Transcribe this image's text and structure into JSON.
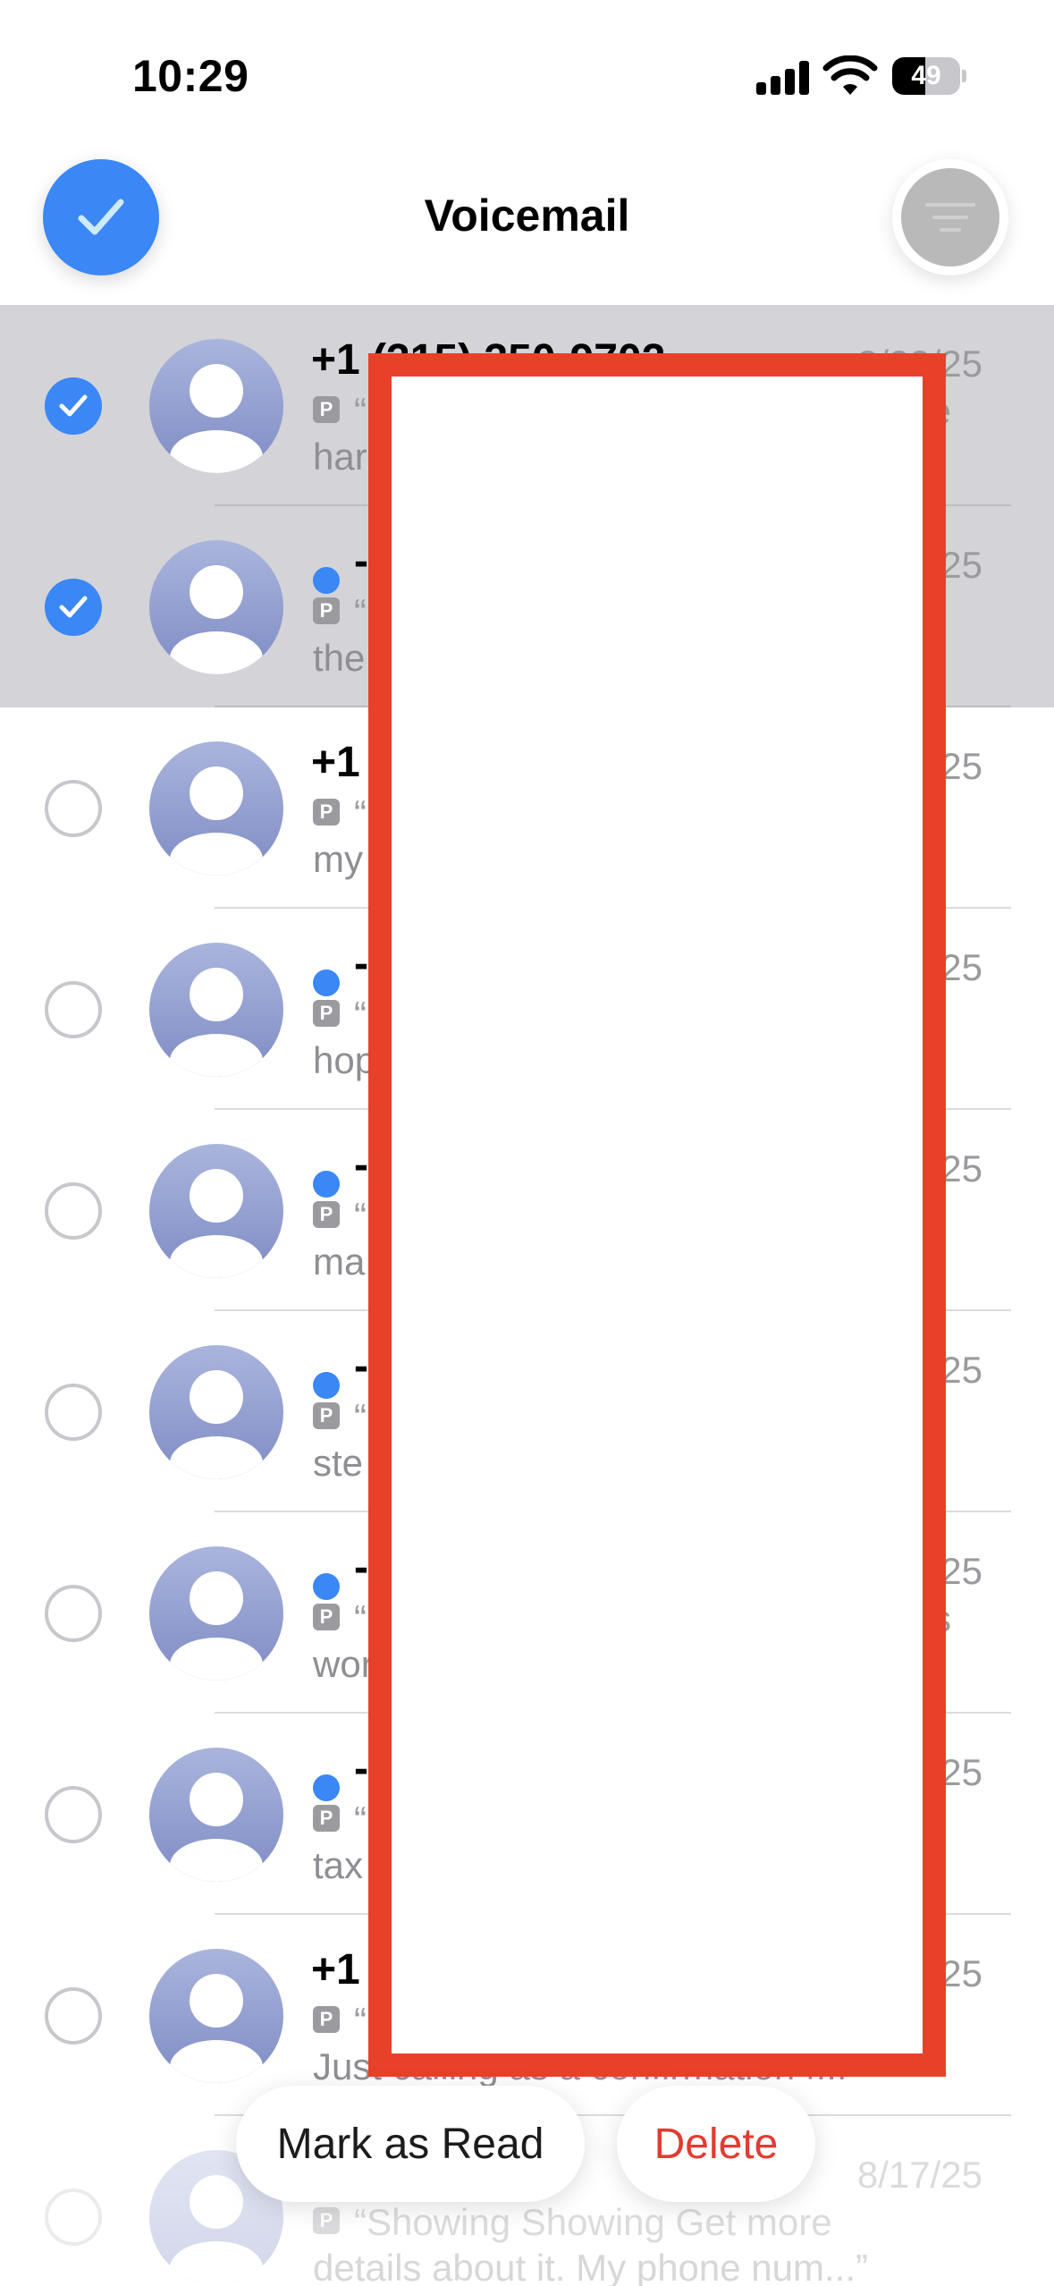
{
  "status_bar": {
    "time": "10:29",
    "battery_level": "49",
    "battery_fraction": 0.49,
    "icons": [
      "cellular-signal-icon",
      "wifi-icon",
      "battery-icon"
    ]
  },
  "nav": {
    "title": "Voicemail",
    "left_icon": "checkmark-icon",
    "right_icon": "filter-icon"
  },
  "colors": {
    "accent": "#3a87f5",
    "delete": "#e23b32",
    "redaction_border": "#e8412a",
    "selected_row": "#d3d3d8",
    "secondary_text": "#9a9a9f"
  },
  "voicemails": [
    {
      "selected": true,
      "unread": false,
      "caller": "+1 (315) 350-9702",
      "date": "8/23/25",
      "badge": "P",
      "line1": "“",
      "line1_end": "e",
      "line2": "har"
    },
    {
      "selected": true,
      "unread": true,
      "caller": "-",
      "date": "25",
      "badge": "P",
      "line1": "“",
      "line1_end": "",
      "line2": "the"
    },
    {
      "selected": false,
      "unread": false,
      "caller": "+1",
      "date": "25",
      "badge": "P",
      "line1": "“",
      "line1_end": "",
      "line2": "my"
    },
    {
      "selected": false,
      "unread": true,
      "caller": "-",
      "date": "25",
      "badge": "P",
      "line1": "“",
      "line1_end": "",
      "line2": "hop"
    },
    {
      "selected": false,
      "unread": true,
      "caller": "-",
      "date": "25",
      "badge": "P",
      "line1": "“",
      "line1_end": "",
      "line2": "ma"
    },
    {
      "selected": false,
      "unread": true,
      "caller": "-",
      "date": "25",
      "badge": "P",
      "line1": "“",
      "line1_end": "",
      "line2": "ste"
    },
    {
      "selected": false,
      "unread": true,
      "caller": "-",
      "date": "25",
      "badge": "P",
      "line1": "“",
      "line1_end": "s",
      "line2": "wor"
    },
    {
      "selected": false,
      "unread": true,
      "caller": "-",
      "date": "25",
      "badge": "P",
      "line1": "“",
      "line1_end": "",
      "line2": "tax"
    },
    {
      "selected": false,
      "unread": false,
      "caller": "+1",
      "date": "25",
      "badge": "P",
      "line1": "“",
      "line1_end": "",
      "line2": "Just calling as a confirmation f..."
    },
    {
      "selected": false,
      "unread": false,
      "caller": "",
      "date": "8/17/25",
      "badge": "P",
      "line1": "“Showing Showing Get more",
      "line1_end": "",
      "line2": "details about it. My phone num...”"
    }
  ],
  "toolbar": {
    "mark_as_read_label": "Mark as Read",
    "delete_label": "Delete"
  }
}
